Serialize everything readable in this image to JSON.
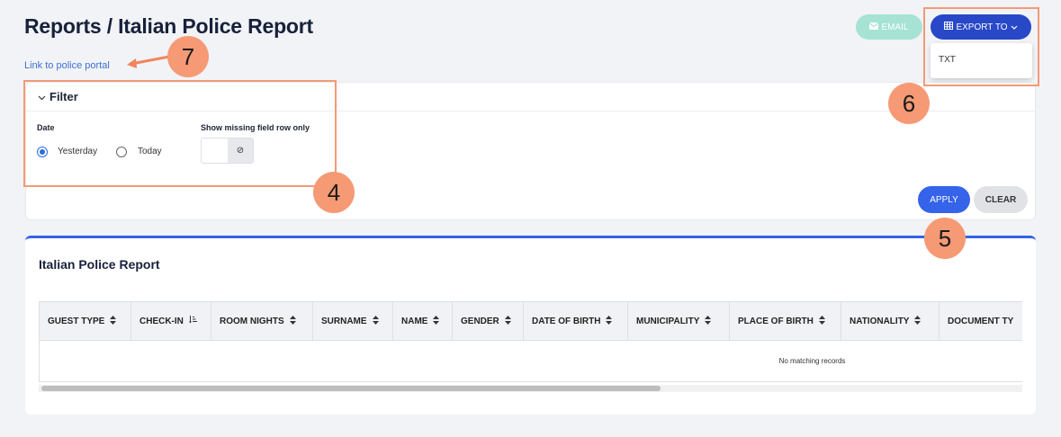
{
  "header": {
    "title": "Reports / Italian Police Report",
    "portal_link": "Link to police portal"
  },
  "actions": {
    "email_label": "EMAIL",
    "export_label": "EXPORT TO",
    "export_options": [
      "TXT"
    ]
  },
  "filter": {
    "title": "Filter",
    "date_label": "Date",
    "date_options": [
      {
        "label": "Yesterday",
        "checked": true
      },
      {
        "label": "Today",
        "checked": false
      }
    ],
    "missing_label": "Show missing field row only",
    "toggle_icon": "⊘",
    "apply_label": "APPLY",
    "clear_label": "CLEAR"
  },
  "table": {
    "title": "Italian Police Report",
    "columns": [
      "GUEST TYPE",
      "CHECK-IN",
      "ROOM NIGHTS",
      "SURNAME",
      "NAME",
      "GENDER",
      "DATE OF BIRTH",
      "MUNICIPALITY",
      "PLACE OF BIRTH",
      "NATIONALITY",
      "DOCUMENT TY"
    ],
    "empty_text": "No matching records"
  },
  "annotations": {
    "badges": [
      "7",
      "6",
      "4",
      "5"
    ]
  },
  "colors": {
    "primary": "#2848c7",
    "apply": "#3563e9",
    "email": "#a6e3d5",
    "highlight": "#f39a76",
    "badge": "#f59a74"
  }
}
